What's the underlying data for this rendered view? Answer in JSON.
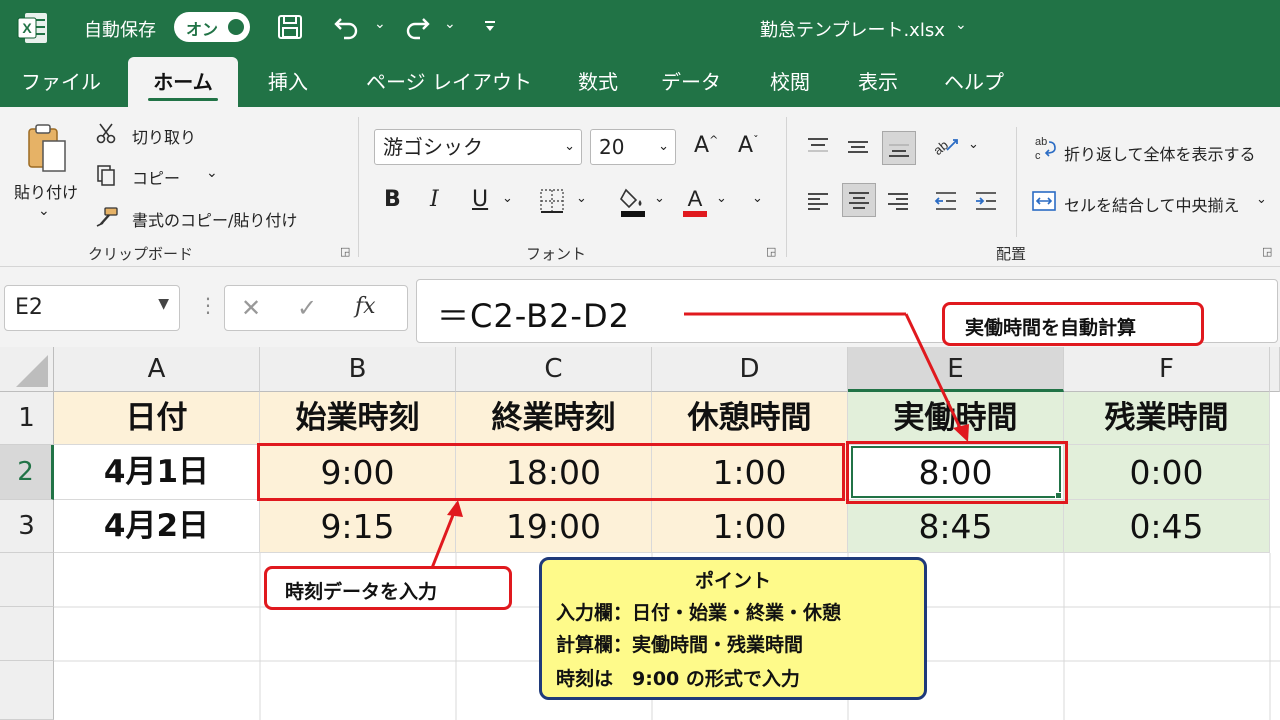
{
  "title_bar": {
    "autosave_label": "自動保存",
    "autosave_state": "オン",
    "filename": "勤怠テンプレート.xlsx"
  },
  "tabs": [
    "ファイル",
    "ホーム",
    "挿入",
    "ページ レイアウト",
    "数式",
    "データ",
    "校閲",
    "表示",
    "ヘルプ"
  ],
  "active_tab": "ホーム",
  "ribbon": {
    "clipboard": {
      "paste": "貼り付け",
      "cut": "切り取り",
      "copy": "コピー",
      "format_painter": "書式のコピー/貼り付け",
      "group_label": "クリップボード"
    },
    "font": {
      "font_name": "游ゴシック",
      "font_size": "20",
      "bold": "B",
      "italic": "I",
      "underline": "U",
      "group_label": "フォント"
    },
    "alignment": {
      "wrap_text": "折り返して全体を表示する",
      "merge_center": "セルを結合して中央揃え",
      "group_label": "配置"
    }
  },
  "formula_bar": {
    "name_box": "E2",
    "fx": "fx",
    "formula": "＝C2-B2-D2"
  },
  "sheet": {
    "columns": [
      "A",
      "B",
      "C",
      "D",
      "E",
      "F"
    ],
    "row_numbers": [
      "1",
      "2",
      "3"
    ],
    "headers": [
      "日付",
      "始業時刻",
      "終業時刻",
      "休憩時間",
      "実働時間",
      "残業時間"
    ],
    "rows": [
      [
        "4月1日",
        "9:00",
        "18:00",
        "1:00",
        "8:00",
        "0:00"
      ],
      [
        "4月2日",
        "9:15",
        "19:00",
        "1:00",
        "8:45",
        "0:45"
      ]
    ],
    "selected_cell": "E2"
  },
  "annotations": {
    "auto_calc": "実働時間を自動計算",
    "time_input": "時刻データを入力",
    "point_title": "ポイント",
    "point_lines": [
      "入力欄：日付・始業・終業・休憩",
      "計算欄：実働時間・残業時間",
      "時刻は　9:00 の形式で入力"
    ]
  },
  "colors": {
    "excel_green": "#217346",
    "input_fill": "#fdf1d8",
    "calc_fill": "#e2efda",
    "callout_red": "#e0191e",
    "point_fill": "#fefa8a",
    "point_border": "#1f3a7a"
  }
}
